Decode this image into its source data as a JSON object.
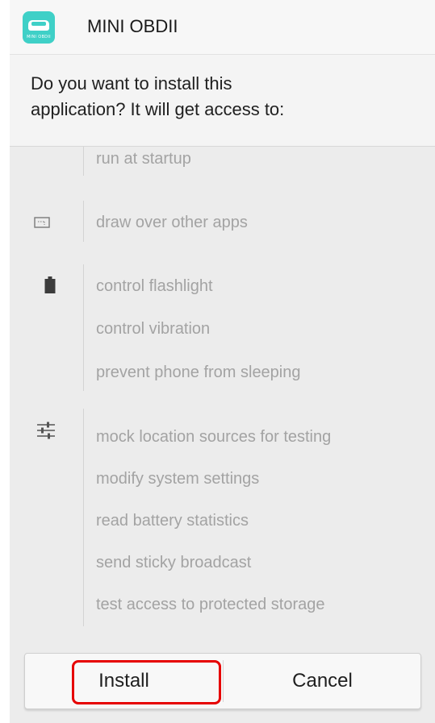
{
  "app": {
    "icon_label": "MINI OBDII",
    "title": "MINI OBDII"
  },
  "prompt": {
    "line1": "Do you want to install this",
    "line2": "application? It will get access to:"
  },
  "permissions": {
    "groups": [
      {
        "icon": "none",
        "items": [
          "run at startup"
        ]
      },
      {
        "icon": "overlay-window-icon",
        "items": [
          "draw over other apps"
        ]
      },
      {
        "icon": "battery-icon",
        "items": [
          "control flashlight",
          "control vibration",
          "prevent phone from sleeping"
        ]
      },
      {
        "icon": "sliders-icon",
        "items": [
          "mock location sources for testing",
          "modify system settings",
          "read battery statistics",
          "send sticky broadcast",
          "test access to protected storage"
        ]
      }
    ]
  },
  "buttons": {
    "install": "Install",
    "cancel": "Cancel"
  },
  "colors": {
    "app_icon_bg": "#3fd0c7",
    "highlight": "#e60000",
    "permission_text": "#a3a3a3"
  }
}
